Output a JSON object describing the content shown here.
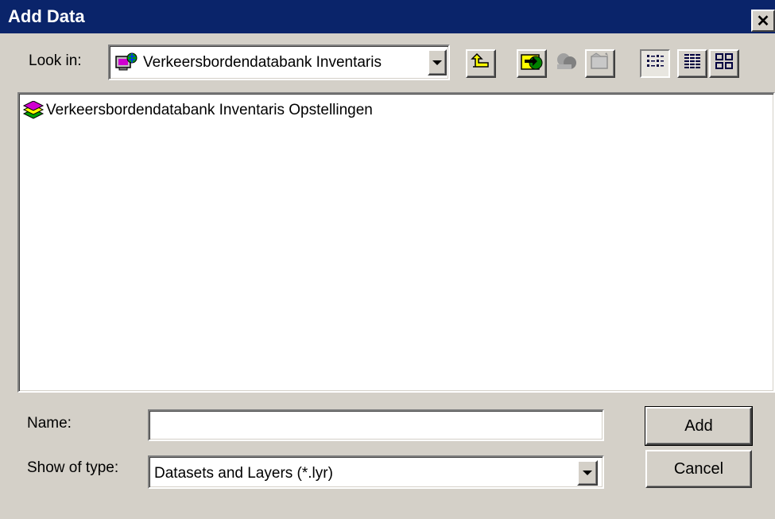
{
  "window": {
    "title": "Add Data",
    "close_glyph": "✕"
  },
  "look_in": {
    "label": "Look in:",
    "value": "Verkeersbordendatabank Inventaris",
    "icon": "database-connection-icon"
  },
  "toolbar": {
    "buttons": [
      {
        "name": "up-one-level-icon"
      },
      {
        "name": "connect-to-folder-icon"
      },
      {
        "name": "disconnect-folder-icon"
      },
      {
        "name": "new-folder-icon"
      },
      {
        "name": "list-view-icon"
      },
      {
        "name": "details-view-icon"
      },
      {
        "name": "thumbnails-view-icon"
      }
    ]
  },
  "file_list": {
    "items": [
      {
        "label": "Verkeersbordendatabank Inventaris Opstellingen",
        "icon": "layer-dataset-icon"
      }
    ]
  },
  "name_field": {
    "label": "Name:",
    "value": ""
  },
  "show_of_type": {
    "label": "Show of type:",
    "value": "Datasets and Layers (*.lyr)"
  },
  "buttons": {
    "add": "Add",
    "cancel": "Cancel"
  }
}
